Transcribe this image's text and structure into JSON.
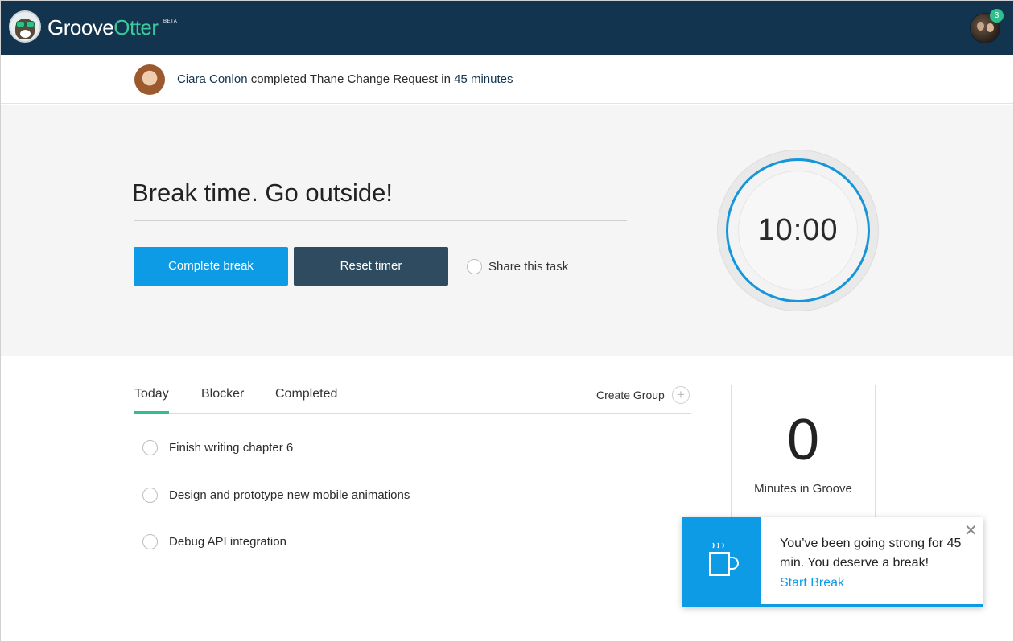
{
  "header": {
    "logo_groove": "Groove",
    "logo_otter": "Otter",
    "logo_beta": "BETA",
    "notification_count": "3",
    "brand_color": "#12344f",
    "accent_green": "#2fbf8f"
  },
  "activity": {
    "user_name": "Ciara Conlon",
    "action": " completed Thane Change Request in ",
    "duration": "45 minutes"
  },
  "break_panel": {
    "title": "Break time. Go outside!",
    "complete_label": "Complete break",
    "reset_label": "Reset timer",
    "share_label": "Share this task",
    "timer": "10:00",
    "primary_color": "#0e9be5",
    "dark_button_color": "#2e4b60"
  },
  "tabs": {
    "items": [
      {
        "label": "Today",
        "active": true
      },
      {
        "label": "Blocker",
        "active": false
      },
      {
        "label": "Completed",
        "active": false
      }
    ],
    "create_group_label": "Create Group",
    "plus_icon": "+"
  },
  "tasks": [
    {
      "label": "Finish writing chapter 6"
    },
    {
      "label": "Design and prototype new mobile animations"
    },
    {
      "label": "Debug API integration"
    }
  ],
  "stats": {
    "value": "0",
    "label": "Minutes in Groove"
  },
  "toast": {
    "icon": "coffee-cup-icon",
    "message": "You’ve been going strong for 45 min. You deserve a break!",
    "link_label": "Start Break",
    "close_icon": "✕"
  }
}
